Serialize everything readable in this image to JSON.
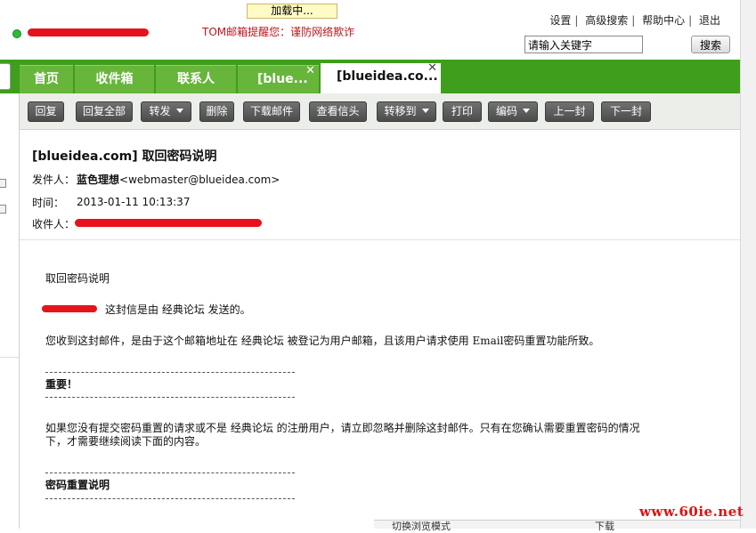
{
  "loading": "加载中...",
  "notice": "TOM邮箱提醒您：谨防网络欺诈",
  "toplinks": [
    "设置",
    "高级搜索",
    "帮助中心",
    "退出"
  ],
  "search": {
    "placeholder": "请输入关键字",
    "value": "请输入关键字",
    "button": "搜索"
  },
  "tabs": [
    "首页",
    "收件箱",
    "联系人",
    "[blue...",
    "[blueidea.co..."
  ],
  "toolbar": {
    "reply": "回复",
    "reply_all": "回复全部",
    "forward": "转发",
    "delete": "删除",
    "download": "下载邮件",
    "view_header": "查看信头",
    "move_to": "转移到",
    "print": "打印",
    "encoding": "编码",
    "prev": "上一封",
    "next": "下一封"
  },
  "mail": {
    "subject": "[blueidea.com] 取回密码说明",
    "from_label": "发件人：",
    "from_name": "蓝色理想",
    "from_addr": "<webmaster@blueidea.com>",
    "time_label": "时间：",
    "time_value": "2013-01-11 10:13:37",
    "to_label": "收件人："
  },
  "body": {
    "line1": "取回密码说明",
    "line2": "这封信是由 经典论坛 发送的。",
    "line3": "您收到这封邮件，是由于这个邮箱地址在 经典论坛 被登记为用户邮箱，且该用户请求使用 Email密码重置功能所致。",
    "important": "重要！",
    "para1": "如果您没有提交密码重置的请求或不是 经典论坛 的注册用户，请立即忽略并删除这封邮件。只有在您确认需要重置密码的情况",
    "para2": "下，才需要继续阅读下面的内容。",
    "reset_title": "密码重置说明"
  },
  "bottom": {
    "mode": "切换浏览模式",
    "download": "下载"
  },
  "watermark": "www.60ie.net",
  "colors": {
    "brand_green": "#3f9e1b",
    "tab_green": "#67b53b",
    "toolbar_btn": "#5a5a5a",
    "notice_red": "#c0141a"
  }
}
